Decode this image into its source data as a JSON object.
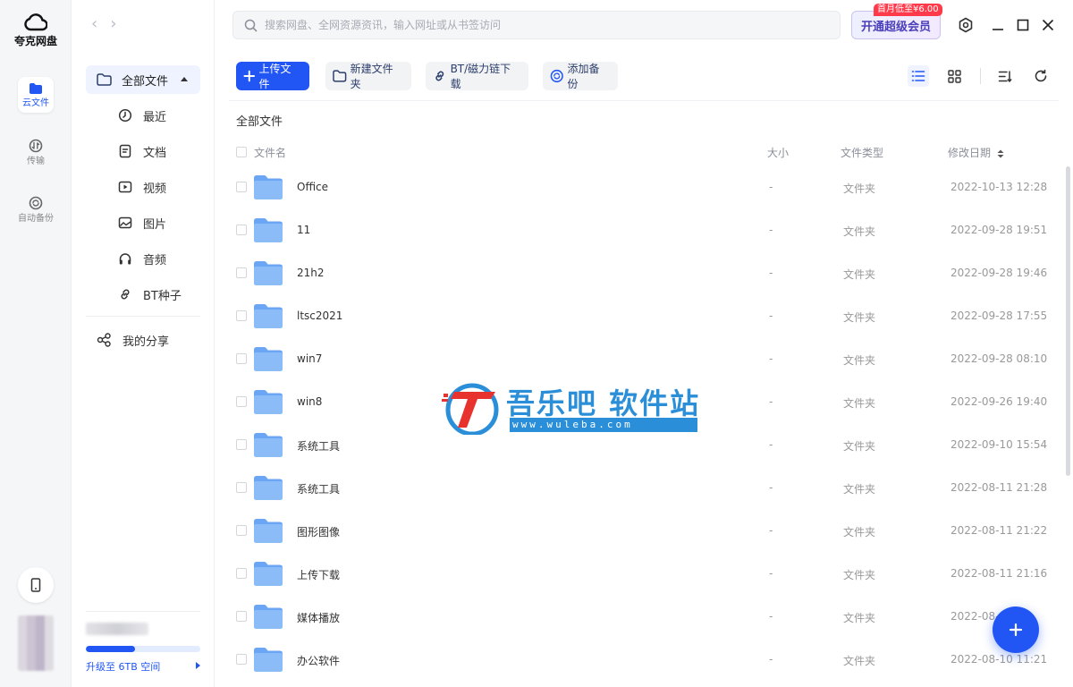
{
  "app": {
    "name": "夸克网盘"
  },
  "rail": {
    "items": [
      {
        "label": "云文件",
        "active": true
      },
      {
        "label": "传输",
        "active": false
      },
      {
        "label": "自动备份",
        "active": false
      }
    ]
  },
  "search": {
    "placeholder": "搜索网盘、全网资源资讯，输入网址或从书签访问"
  },
  "vip": {
    "label": "开通超级会员",
    "badge": "首月低至¥6.00"
  },
  "nav": {
    "all_files": "全部文件",
    "subitems": [
      {
        "label": "最近",
        "icon": "clock-icon"
      },
      {
        "label": "文档",
        "icon": "document-icon"
      },
      {
        "label": "视频",
        "icon": "video-icon"
      },
      {
        "label": "图片",
        "icon": "image-icon"
      },
      {
        "label": "音频",
        "icon": "headphones-icon"
      },
      {
        "label": "BT种子",
        "icon": "link-icon"
      }
    ],
    "share": "我的分享",
    "upgrade": "升级至 6TB 空间",
    "storage_used_fraction": 0.43
  },
  "toolbar": {
    "upload": "上传文件",
    "new_folder": "新建文件夹",
    "bt_download": "BT/磁力链下载",
    "add_backup": "添加备份"
  },
  "breadcrumb": "全部文件",
  "columns": {
    "name": "文件名",
    "size": "大小",
    "type": "文件类型",
    "date": "修改日期"
  },
  "rows": [
    {
      "name": "Office",
      "size": "-",
      "type": "文件夹",
      "date": "2022-10-13 12:28"
    },
    {
      "name": "11",
      "size": "-",
      "type": "文件夹",
      "date": "2022-09-28 19:51"
    },
    {
      "name": "21h2",
      "size": "-",
      "type": "文件夹",
      "date": "2022-09-28 19:46"
    },
    {
      "name": "ltsc2021",
      "size": "-",
      "type": "文件夹",
      "date": "2022-09-28 17:55"
    },
    {
      "name": "win7",
      "size": "-",
      "type": "文件夹",
      "date": "2022-09-28 08:10"
    },
    {
      "name": "win8",
      "size": "-",
      "type": "文件夹",
      "date": "2022-09-26 19:40"
    },
    {
      "name": "系统工具",
      "size": "-",
      "type": "文件夹",
      "date": "2022-09-10 15:54"
    },
    {
      "name": "系统工具",
      "size": "-",
      "type": "文件夹",
      "date": "2022-08-11 21:28"
    },
    {
      "name": "图形图像",
      "size": "-",
      "type": "文件夹",
      "date": "2022-08-11 21:22"
    },
    {
      "name": "上传下载",
      "size": "-",
      "type": "文件夹",
      "date": "2022-08-11 21:16"
    },
    {
      "name": "媒体播放",
      "size": "-",
      "type": "文件夹",
      "date": "2022-08-1"
    },
    {
      "name": "办公软件",
      "size": "-",
      "type": "文件夹",
      "date": "2022-08-10 11:21"
    }
  ],
  "watermark": {
    "title": "吾乐吧 软件站",
    "url": "www.wuleba.com"
  },
  "colors": {
    "accent": "#2156f5",
    "folder": "#7fb2f5",
    "vip_badge": "#ff3b4b"
  }
}
